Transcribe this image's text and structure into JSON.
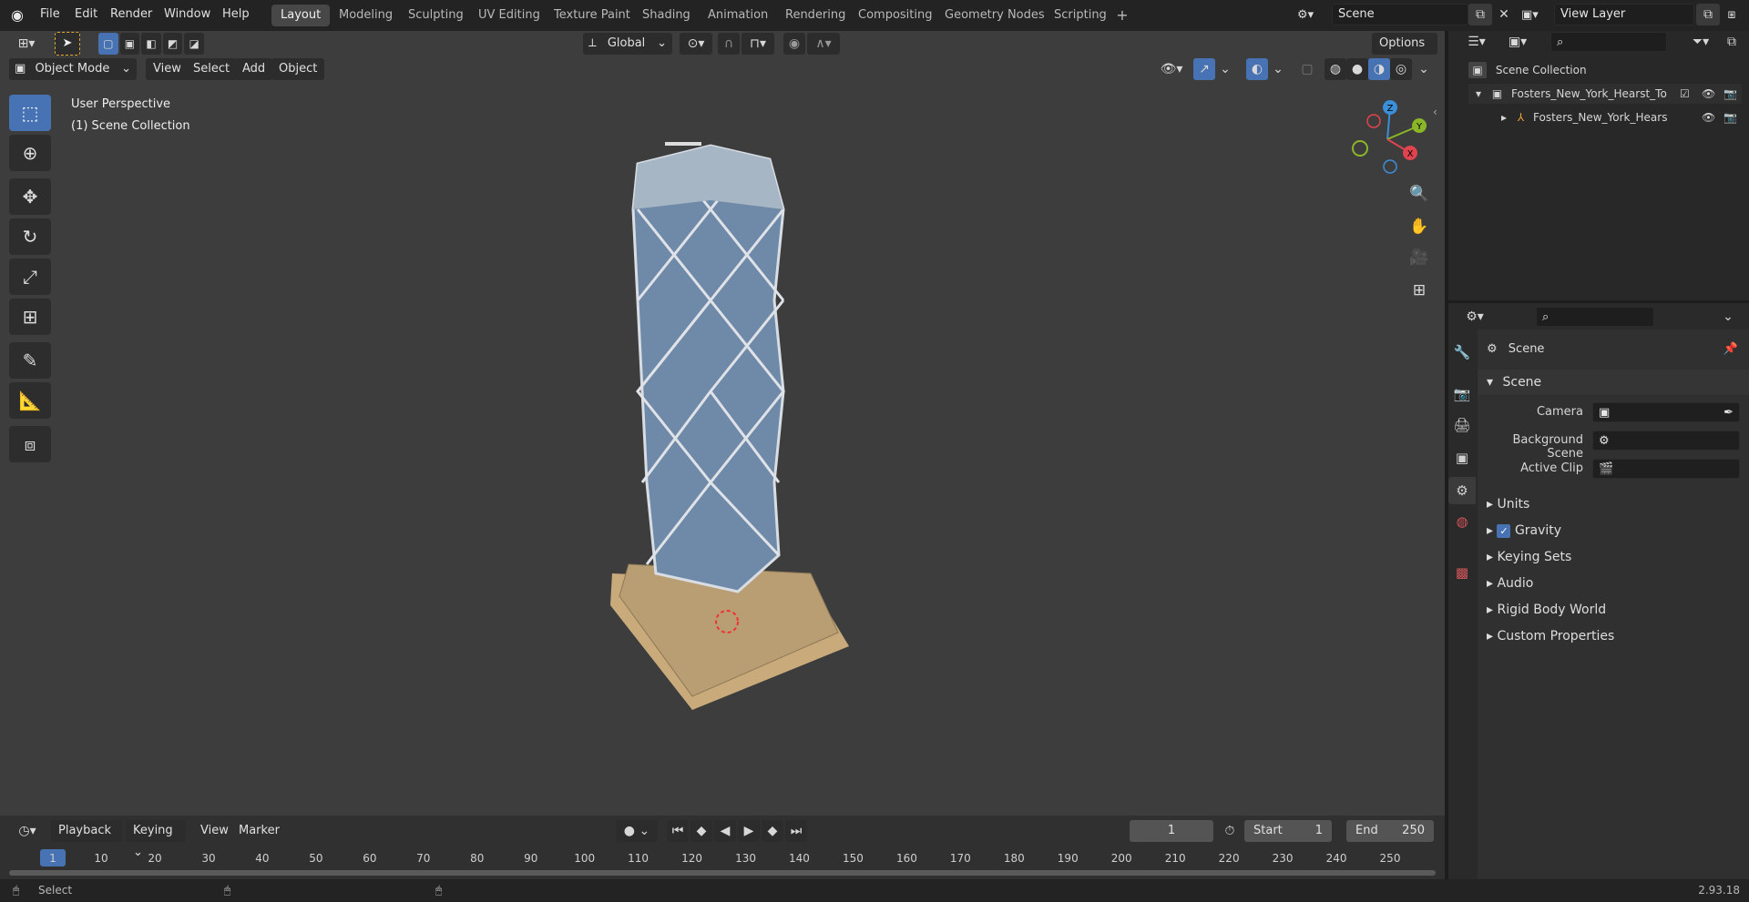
{
  "topbar": {
    "menus": [
      "File",
      "Edit",
      "Render",
      "Window",
      "Help"
    ],
    "workspaces": [
      "Layout",
      "Modeling",
      "Sculpting",
      "UV Editing",
      "Texture Paint",
      "Shading",
      "Animation",
      "Rendering",
      "Compositing",
      "Geometry Nodes",
      "Scripting"
    ],
    "active_workspace": "Layout",
    "add_workspace_icon": "plus-icon",
    "scene_name": "Scene",
    "view_layer_name": "View Layer"
  },
  "viewport_header": {
    "mode": "Object Mode",
    "menus": [
      "View",
      "Select",
      "Add",
      "Object"
    ],
    "orientation": "Global",
    "options_label": "Options"
  },
  "viewport": {
    "perspective": "User Perspective",
    "collection_label": "(1) Scene Collection",
    "gizmo": {
      "x": "X",
      "y": "Y",
      "z": "Z"
    }
  },
  "tools": [
    "select-box-icon",
    "cursor-icon",
    "move-icon",
    "rotate-icon",
    "scale-icon",
    "transform-icon",
    "annotate-icon",
    "measure-icon",
    "add-cube-icon"
  ],
  "timeline": {
    "menus": [
      "Playback",
      "Keying",
      "View",
      "Marker"
    ],
    "current_frame": "1",
    "start_label": "Start",
    "start_value": "1",
    "end_label": "End",
    "end_value": "250",
    "ticks": [
      "1",
      "10",
      "20",
      "30",
      "40",
      "50",
      "60",
      "70",
      "80",
      "90",
      "100",
      "110",
      "120",
      "130",
      "140",
      "150",
      "160",
      "170",
      "180",
      "190",
      "200",
      "210",
      "220",
      "230",
      "240",
      "250"
    ]
  },
  "outliner": {
    "root": "Scene Collection",
    "items": [
      {
        "label": "Fosters_New_York_Hearst_To"
      },
      {
        "label": "Fosters_New_York_Hears"
      }
    ]
  },
  "properties": {
    "context_title": "Scene",
    "panel_title": "Scene",
    "camera_label": "Camera",
    "background_scene_label": "Background Scene",
    "active_clip_label": "Active Clip",
    "sections": [
      "Units",
      "Gravity",
      "Keying Sets",
      "Audio",
      "Rigid Body World",
      "Custom Properties"
    ],
    "gravity_checked": true
  },
  "statusbar": {
    "select_label": "Select",
    "version": "2.93.18"
  },
  "colors": {
    "accent": "#4772b3",
    "axis_x": "#e0444e",
    "axis_y": "#8bb628",
    "axis_z": "#3b8ed8"
  }
}
